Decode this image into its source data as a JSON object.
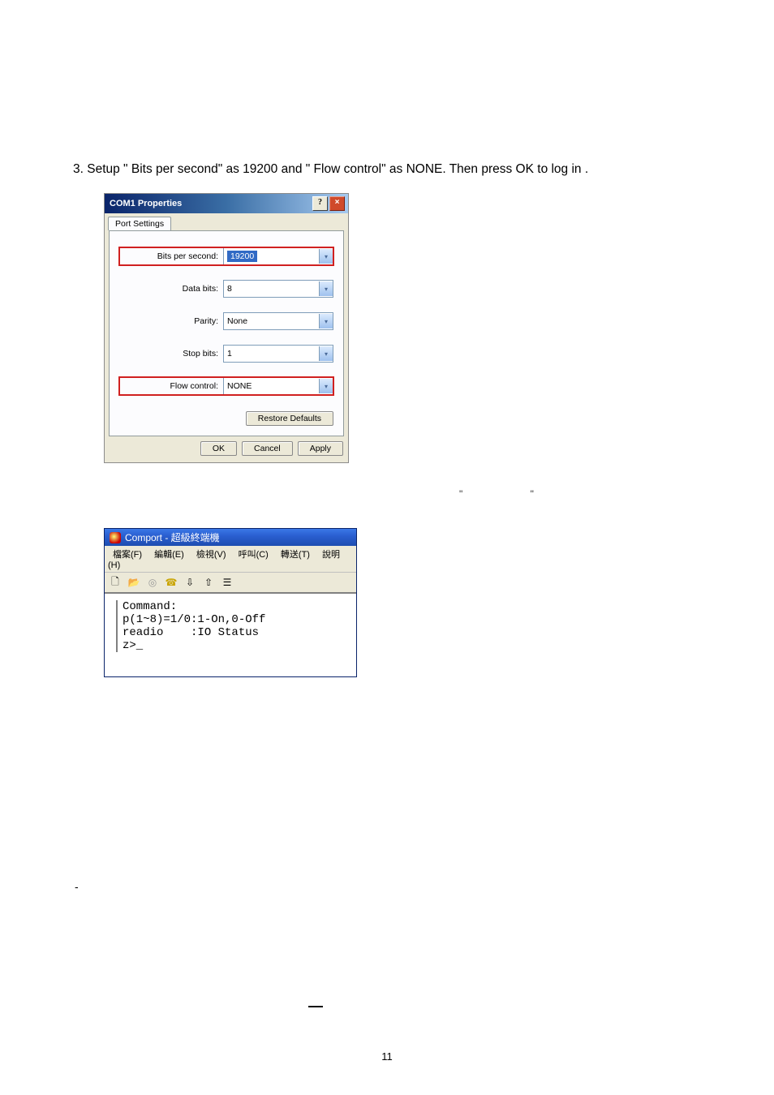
{
  "instruction": "3. Setup \" Bits per second\" as 19200 and \" Flow control\" as NONE. Then press OK to log in .",
  "dialog": {
    "title": "COM1 Properties",
    "tab": "Port Settings",
    "fields": {
      "bits_per_second": {
        "label": "Bits per second:",
        "value": "19200"
      },
      "data_bits": {
        "label": "Data bits:",
        "value": "8"
      },
      "parity": {
        "label": "Parity:",
        "value": "None"
      },
      "stop_bits": {
        "label": "Stop bits:",
        "value": "1"
      },
      "flow_control": {
        "label": "Flow control:",
        "value": "NONE"
      }
    },
    "buttons": {
      "restore": "Restore Defaults",
      "ok": "OK",
      "cancel": "Cancel",
      "apply": "Apply"
    }
  },
  "floating_quotes": "\"  \"",
  "terminal": {
    "title": "Comport - 超級終端機",
    "menus": [
      "檔案(F)",
      "編輯(E)",
      "檢視(V)",
      "呼叫(C)",
      "轉送(T)",
      "說明(H)"
    ],
    "toolbar_icons": [
      "new-icon",
      "open-icon",
      "disconnect-icon",
      "call-icon",
      "send-icon",
      "receive-icon",
      "properties-icon"
    ],
    "body": "Command:\np(1~8)=1/0:1-On,0-Off\nreadio    :IO Status\nz>_"
  },
  "stray_dash": "-",
  "stray_dash2": "—",
  "page_number": "11"
}
